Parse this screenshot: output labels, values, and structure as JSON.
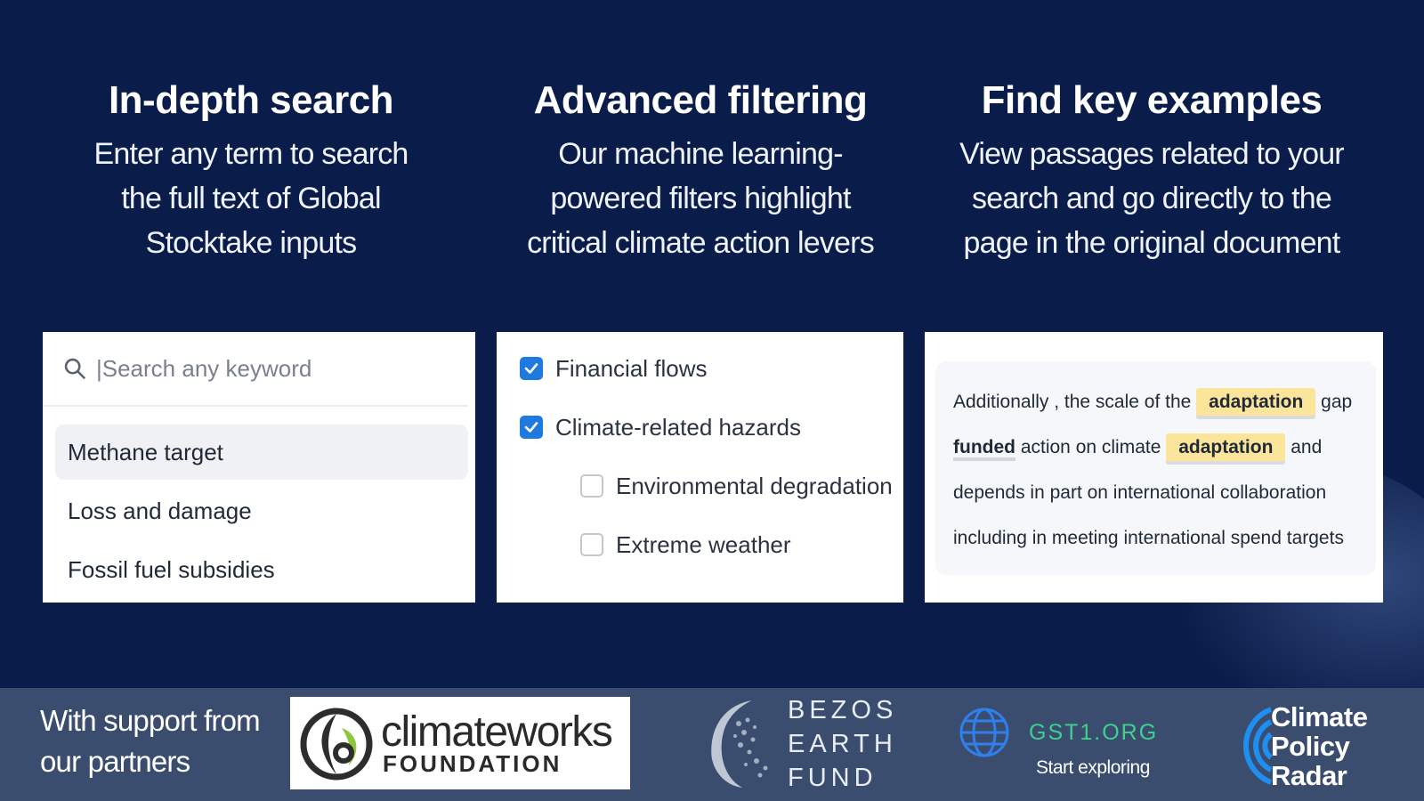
{
  "colors": {
    "background": "#0a1d4a",
    "footer": "#3a4d6e",
    "checkbox": "#1f7ae0",
    "highlight": "#fbe59a",
    "gst_green": "#3fcf8e"
  },
  "features": [
    {
      "title": "In-depth search",
      "desc": [
        "Enter any term to search",
        "the full text of Global",
        "Stocktake inputs"
      ]
    },
    {
      "title": "Advanced filtering",
      "desc": [
        "Our machine learning-",
        "powered filters highlight",
        "critical climate action levers"
      ]
    },
    {
      "title": "Find key examples",
      "desc": [
        "View passages related to your",
        "search and go directly to the",
        "page in the original document"
      ]
    }
  ],
  "search": {
    "icon": "search-icon",
    "placeholder": "|Search any keyword",
    "suggestions": [
      "Methane target",
      "Loss and damage",
      "Fossil fuel subsidies"
    ]
  },
  "filters": [
    {
      "label": "Financial flows",
      "checked": true
    },
    {
      "label": "Climate-related hazards",
      "checked": true
    },
    {
      "label": "Environmental degradation",
      "checked": false
    },
    {
      "label": "Extreme weather",
      "checked": false
    }
  ],
  "passage": {
    "l1a": "Additionally , the scale of the ",
    "l1hl": "adaptation",
    "l1b": " gap",
    "l2ul": "funded",
    "l2a": " action on climate ",
    "l2hl": "adaptation",
    "l2b": " and",
    "l3": "depends in part on international collaboration",
    "l4": "including in meeting international spend targets"
  },
  "footer": {
    "support": [
      "With support from",
      "our partners"
    ],
    "climateworks": {
      "name": "climateworks",
      "sub": "FOUNDATION"
    },
    "bezos": [
      "BEZOS",
      "EARTH",
      "FUND"
    ],
    "gst": {
      "name": "GST1.ORG",
      "sub": "Start exploring"
    },
    "cpr": [
      "Climate",
      "Policy",
      "Radar"
    ]
  }
}
